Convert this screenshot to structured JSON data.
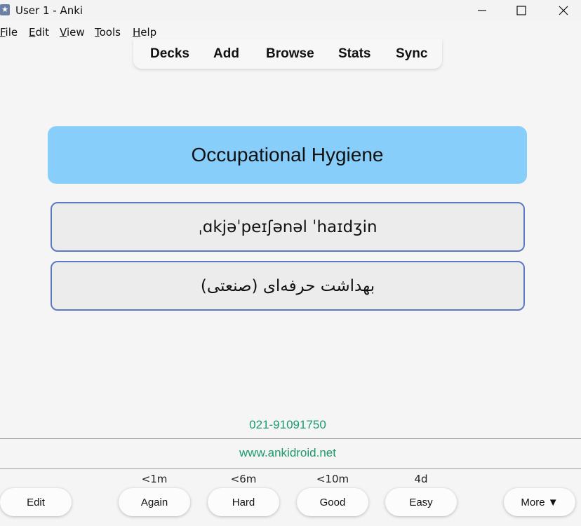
{
  "window": {
    "title": "User 1 - Anki",
    "app_icon": "anki-star-icon"
  },
  "menu": {
    "file": {
      "u": "F",
      "rest": "ile"
    },
    "edit": {
      "u": "E",
      "rest": "dit"
    },
    "view": {
      "u": "V",
      "rest": "iew"
    },
    "tools": {
      "u": "T",
      "rest": "ools"
    },
    "help": {
      "u": "H",
      "rest": "elp"
    }
  },
  "toolbar": {
    "decks": "Decks",
    "add": "Add",
    "browse": "Browse",
    "stats": "Stats",
    "sync": "Sync"
  },
  "card": {
    "word": "Occupational Hygiene",
    "phonetic": "ˌɑkjəˈpeɪʃənəl ˈhaɪdʒin",
    "translation": "بهداشت حرفه‌ای (صنعتی)",
    "phone": "021-91091750",
    "url": "www.ankidroid.net"
  },
  "answer_buttons": {
    "edit": "Edit",
    "again": {
      "label": "Again",
      "interval": "<1m"
    },
    "hard": {
      "label": "Hard",
      "interval": "<6m"
    },
    "good": {
      "label": "Good",
      "interval": "<10m"
    },
    "easy": {
      "label": "Easy",
      "interval": "4d"
    },
    "more": "More ▼"
  },
  "colors": {
    "title_card": "#87cefa",
    "box_border": "#5b79c4",
    "link_green": "#1b9a6a"
  }
}
